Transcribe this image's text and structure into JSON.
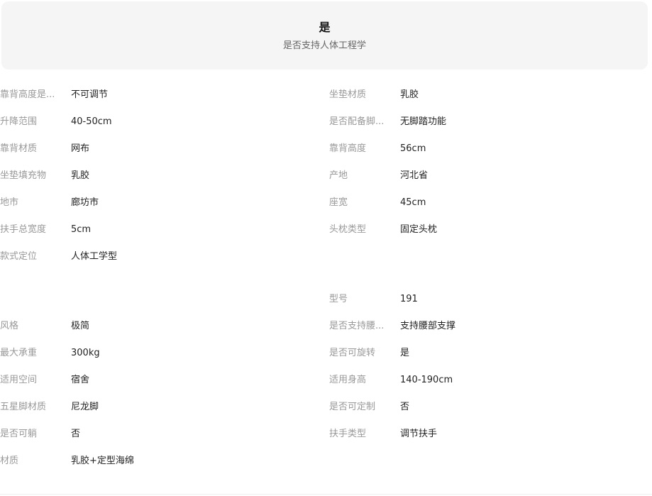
{
  "highlight": {
    "value": "是",
    "label": "是否支持人体工程学"
  },
  "specs": [
    {
      "label": "靠背高度是...",
      "value": "不可调节"
    },
    {
      "label": "坐垫材质",
      "value": "乳胶"
    },
    {
      "label": "升降范围",
      "value": "40-50cm"
    },
    {
      "label": "是否配备脚...",
      "value": "无脚踏功能"
    },
    {
      "label": "靠背材质",
      "value": "网布"
    },
    {
      "label": "靠背高度",
      "value": "56cm"
    },
    {
      "label": "坐垫填充物",
      "value": "乳胶"
    },
    {
      "label": "产地",
      "value": "河北省"
    },
    {
      "label": "地市",
      "value": "廊坊市"
    },
    {
      "label": "座宽",
      "value": "45cm"
    },
    {
      "label": "扶手总宽度",
      "value": "5cm"
    },
    {
      "label": "头枕类型",
      "value": "固定头枕"
    },
    {
      "label": "款式定位",
      "value": "人体工学型"
    },
    {
      "label": "型号",
      "value": "191"
    },
    {
      "label": "风格",
      "value": "极简"
    },
    {
      "label": "是否支持腰...",
      "value": "支持腰部支撑"
    },
    {
      "label": "最大承重",
      "value": "300kg"
    },
    {
      "label": "是否可旋转",
      "value": "是"
    },
    {
      "label": "适用空间",
      "value": "宿舍"
    },
    {
      "label": "适用身高",
      "value": "140-190cm"
    },
    {
      "label": "五星脚材质",
      "value": "尼龙脚"
    },
    {
      "label": "是否可定制",
      "value": "否"
    },
    {
      "label": "是否可躺",
      "value": "否"
    },
    {
      "label": "扶手类型",
      "value": "调节扶手"
    },
    {
      "label": "材质",
      "value": "乳胶+定型海绵"
    }
  ]
}
